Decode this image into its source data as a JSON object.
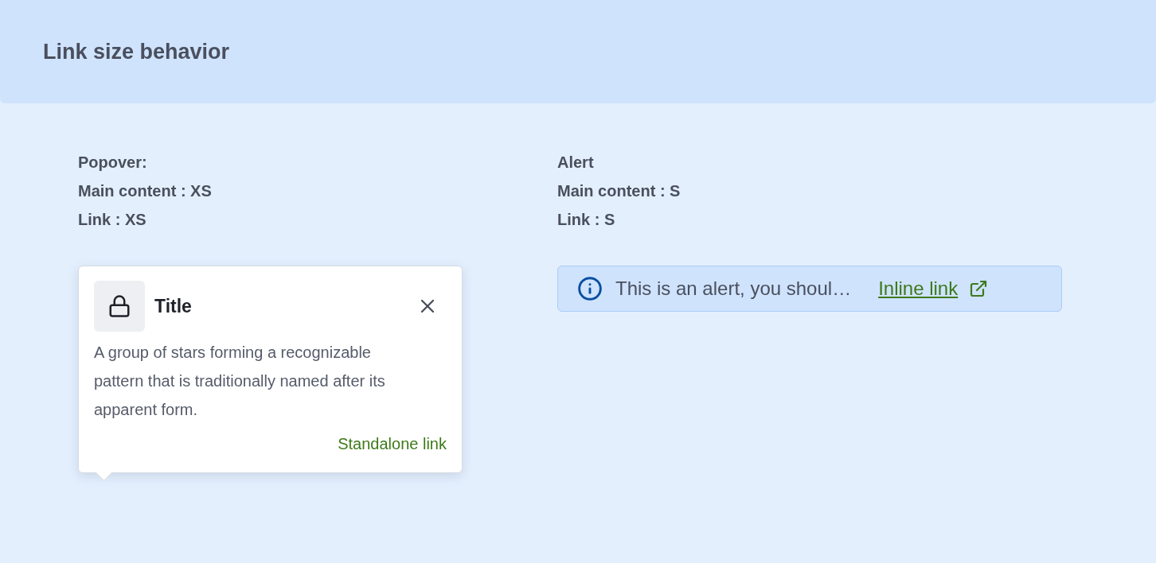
{
  "header": {
    "title": "Link size behavior"
  },
  "popover_section": {
    "labels": [
      "Popover:",
      "Main content : XS",
      "Link : XS"
    ],
    "popover": {
      "title": "Title",
      "body": "A group of stars forming a recognizable pattern that is traditionally named after its apparent form.",
      "link": "Standalone link"
    }
  },
  "alert_section": {
    "labels": [
      "Alert",
      "Main content : S",
      "Link : S"
    ],
    "alert": {
      "text": "This is an alert, you shoul…",
      "link": "Inline link"
    }
  }
}
